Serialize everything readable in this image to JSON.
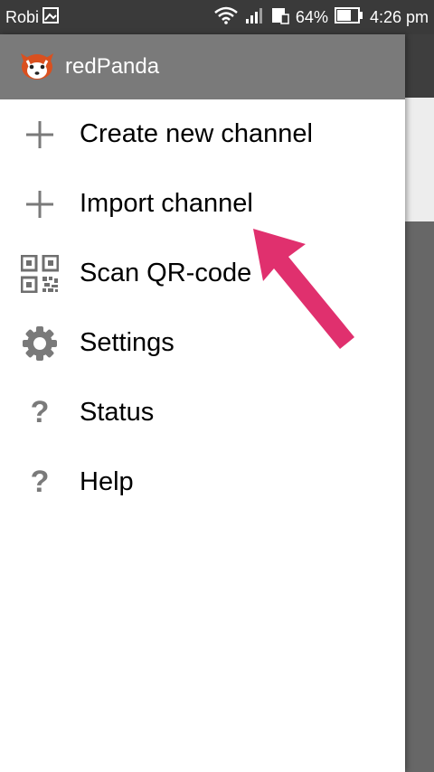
{
  "status_bar": {
    "carrier": "Robi",
    "battery": "64%",
    "time": "4:26 pm"
  },
  "drawer": {
    "app_title": "redPanda",
    "menu": [
      {
        "label": "Create new channel",
        "icon": "plus-icon"
      },
      {
        "label": "Import channel",
        "icon": "plus-icon"
      },
      {
        "label": "Scan QR-code",
        "icon": "qr-code-icon"
      },
      {
        "label": "Settings",
        "icon": "gear-icon"
      },
      {
        "label": "Status",
        "icon": "question-icon"
      },
      {
        "label": "Help",
        "icon": "question-icon"
      }
    ]
  },
  "annotation": {
    "arrow_color": "#e0306e"
  },
  "colors": {
    "header_bg": "#7a7a7a",
    "status_bg": "#3a3a3a",
    "icon_gray": "#7a7a7a"
  }
}
